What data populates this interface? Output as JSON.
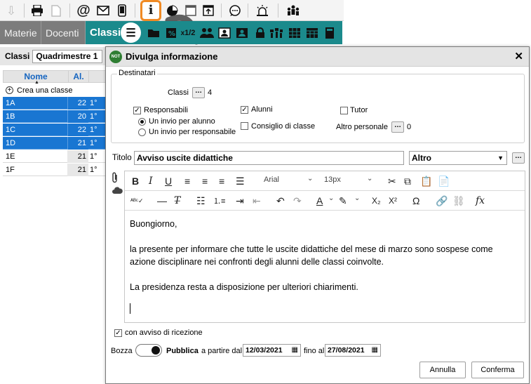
{
  "toolbar": {
    "icons": [
      "download-icon",
      "print-icon",
      "document-icon",
      "email-at-icon",
      "envelope-icon",
      "mobile-icon",
      "info-icon",
      "pie-chart-icon",
      "window-icon",
      "upload-window-icon",
      "chat-icon",
      "alarm-icon",
      "people-icon"
    ],
    "highlight_color": "#f08a24"
  },
  "nav": {
    "tabs": [
      "Materie",
      "Docenti",
      "Classi"
    ],
    "active_tab": "Classi",
    "active_color": "#1b8a8c",
    "timetable_fraction": "1/2",
    "subscript_label": "x"
  },
  "left": {
    "classi_label": "Classi",
    "period": "Quadrimestre 1",
    "columns": [
      "Nome",
      "Al."
    ],
    "create_label": "Crea una classe",
    "rows": [
      {
        "name": "1A",
        "students": "22",
        "level": "1°",
        "selected": true
      },
      {
        "name": "1B",
        "students": "20",
        "level": "1°",
        "selected": true
      },
      {
        "name": "1C",
        "students": "22",
        "level": "1°",
        "selected": true
      },
      {
        "name": "1D",
        "students": "21",
        "level": "1°",
        "selected": true
      },
      {
        "name": "1E",
        "students": "21",
        "level": "1°",
        "selected": false
      },
      {
        "name": "1F",
        "students": "21",
        "level": "1°",
        "selected": false
      }
    ]
  },
  "dialog": {
    "badge": "NOT",
    "title": "Divulga informazione",
    "close": "✕",
    "recipients_legend": "Destinatari",
    "classi_label": "Classi",
    "classi_count": "4",
    "responsabili_label": "Responsabili",
    "responsabili_checked": true,
    "radio_per_student": "Un invio per alunno",
    "radio_per_responsible": "Un invio per responsabile",
    "alunni_label": "Alunni",
    "alunni_checked": true,
    "consiglio_label": "Consiglio di classe",
    "tutor_label": "Tutor",
    "altro_personale_label": "Altro personale",
    "altro_personale_count": "0",
    "titolo_label": "Titolo",
    "titolo_value": "Avviso uscite didattiche",
    "category_value": "Altro",
    "editor": {
      "font": "Arial",
      "size": "13px",
      "greeting": "Buongiorno,",
      "paragraph1": "la presente per informare che tutte le uscite didattiche del mese di marzo sono sospese come azione disciplinare nei confronti degli alunni delle classi coinvolte.",
      "paragraph2": "La presidenza resta a disposizione per ulteriori chiarimenti."
    },
    "receipt_label": "con avviso di ricezione",
    "receipt_checked": true,
    "draft_label": "Bozza",
    "public_label": "Pubblica",
    "from_label": "a partire dal",
    "from_date": "12/03/2021",
    "to_label": "fino al",
    "to_date": "27/08/2021",
    "cancel_label": "Annulla",
    "confirm_label": "Conferma"
  }
}
